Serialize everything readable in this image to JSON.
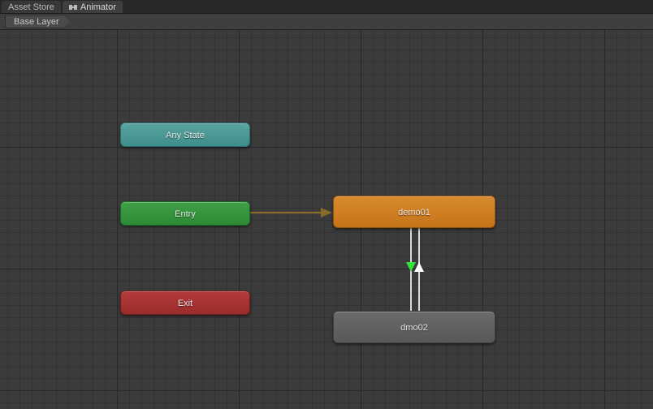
{
  "tabs": {
    "asset_store": "Asset Store",
    "animator": "Animator"
  },
  "layer": {
    "base": "Base Layer"
  },
  "nodes": {
    "any_state": "Any State",
    "entry": "Entry",
    "exit": "Exit",
    "demo01": "demo01",
    "dmo02": "dmo02"
  }
}
